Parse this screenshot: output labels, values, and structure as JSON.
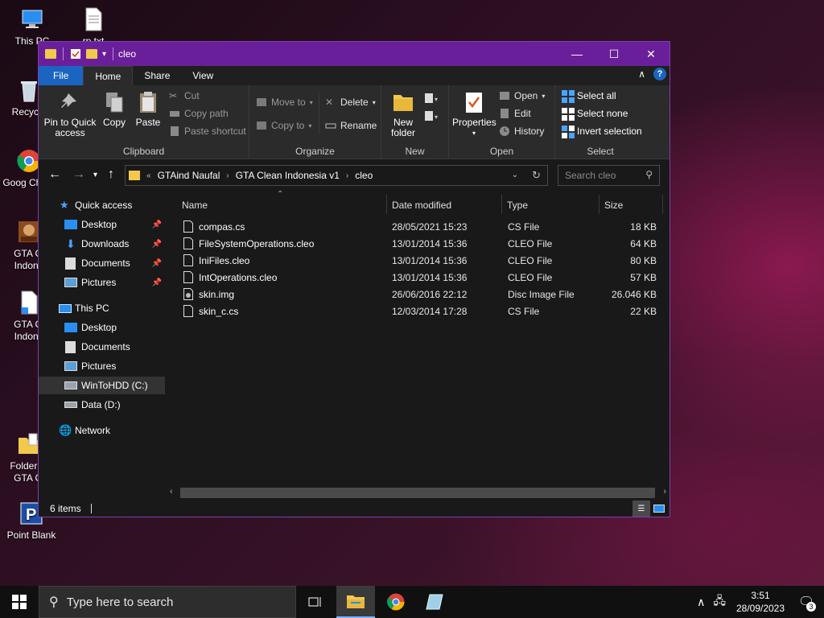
{
  "desktop": {
    "icons": [
      {
        "label": "This PC",
        "name": "this-pc"
      },
      {
        "label": "rp.txt",
        "name": "rp-txt"
      },
      {
        "label": "Recycle",
        "name": "recycle-bin"
      },
      {
        "label": "Goog Chron",
        "name": "google-chrome"
      },
      {
        "label": "GTA Cl Indone",
        "name": "gta-clean-indonesia-1"
      },
      {
        "label": "GTA Cl Indone",
        "name": "gta-clean-indonesia-2"
      },
      {
        "label": "Folder M GTA Cl",
        "name": "folder-gta-clean"
      },
      {
        "label": "Point Blank",
        "name": "point-blank"
      }
    ]
  },
  "window": {
    "title": "cleo",
    "controls": {
      "minimize": "—",
      "maximize": "☐",
      "close": "✕"
    }
  },
  "ribbon": {
    "tabs": [
      "File",
      "Home",
      "Share",
      "View"
    ],
    "active_tab": "Home",
    "clipboard": {
      "label": "Clipboard",
      "pin": "Pin to Quick access",
      "copy": "Copy",
      "paste": "Paste",
      "cut": "Cut",
      "copy_path": "Copy path",
      "paste_shortcut": "Paste shortcut"
    },
    "organize": {
      "label": "Organize",
      "move_to": "Move to",
      "copy_to": "Copy to",
      "delete": "Delete",
      "rename": "Rename"
    },
    "new": {
      "label": "New",
      "new_folder": "New folder"
    },
    "open": {
      "label": "Open",
      "properties": "Properties",
      "open": "Open",
      "edit": "Edit",
      "history": "History"
    },
    "select": {
      "label": "Select",
      "select_all": "Select all",
      "select_none": "Select none",
      "invert": "Invert selection"
    }
  },
  "address": {
    "crumbs": [
      "GTAind Naufal",
      "GTA Clean Indonesia v1",
      "cleo"
    ],
    "search_placeholder": "Search cleo"
  },
  "nav": {
    "quick_access": "Quick access",
    "qa_items": [
      "Desktop",
      "Downloads",
      "Documents",
      "Pictures"
    ],
    "this_pc": "This PC",
    "pc_items": [
      "Desktop",
      "Documents",
      "Pictures",
      "WinToHDD (C:)",
      "Data (D:)"
    ],
    "network": "Network"
  },
  "columns": {
    "name": "Name",
    "date": "Date modified",
    "type": "Type",
    "size": "Size"
  },
  "files": [
    {
      "name": "compas.cs",
      "date": "28/05/2021 15:23",
      "type": "CS File",
      "size": "18 KB"
    },
    {
      "name": "FileSystemOperations.cleo",
      "date": "13/01/2014 15:36",
      "type": "CLEO File",
      "size": "64 KB"
    },
    {
      "name": "IniFiles.cleo",
      "date": "13/01/2014 15:36",
      "type": "CLEO File",
      "size": "80 KB"
    },
    {
      "name": "IntOperations.cleo",
      "date": "13/01/2014 15:36",
      "type": "CLEO File",
      "size": "57 KB"
    },
    {
      "name": "skin.img",
      "date": "26/06/2016 22:12",
      "type": "Disc Image File",
      "size": "26.046 KB"
    },
    {
      "name": "skin_c.cs",
      "date": "12/03/2014 17:28",
      "type": "CS File",
      "size": "22 KB"
    }
  ],
  "status": {
    "count": "6 items"
  },
  "taskbar": {
    "search_placeholder": "Type here to search",
    "time": "3:51",
    "date": "28/09/2023",
    "notifications": "3"
  }
}
